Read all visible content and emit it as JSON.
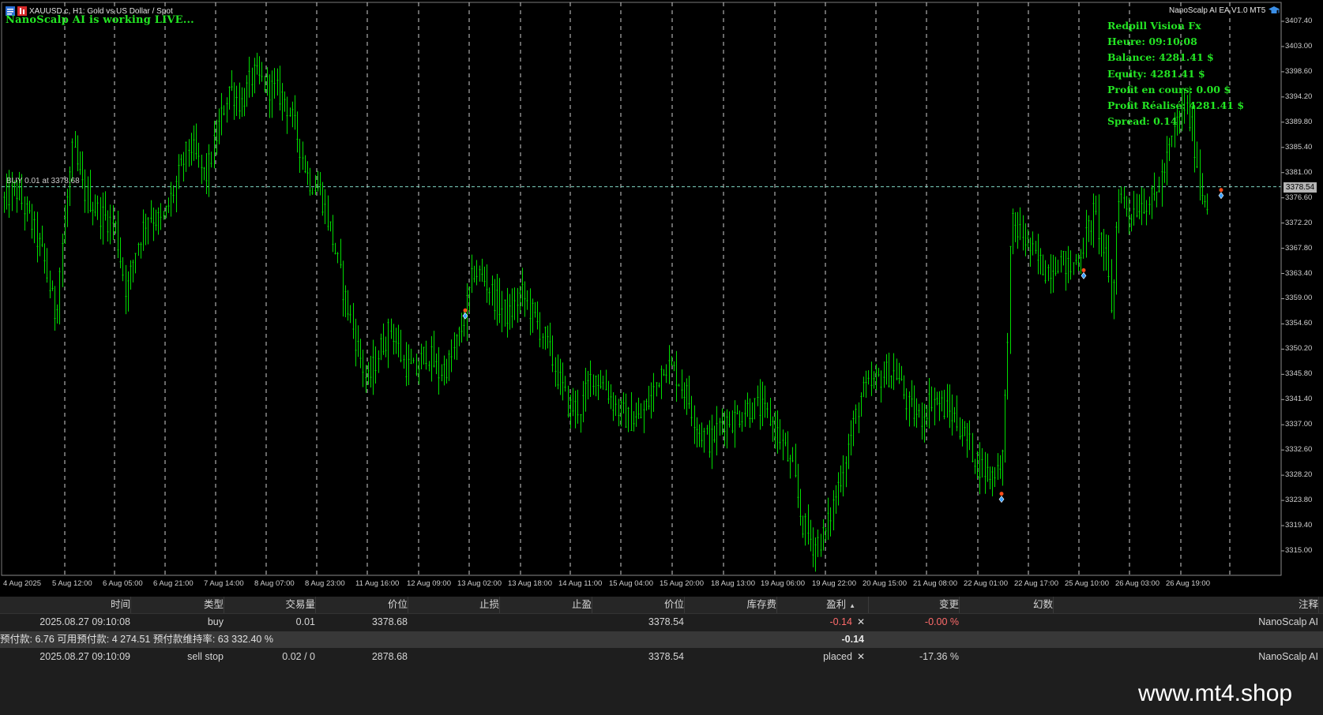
{
  "chart": {
    "symbol_header": "XAUUSD.c, H1:  Gold vs US Dollar / Spot",
    "live_status": "NanoScalp AI is working LIVE...",
    "ea_title": "NanoScalp AI EA V1.0 MT5",
    "info_panel": [
      "Redpill Vision Fx",
      "Heure: 09:10:08",
      "Balance: 4281.41 $",
      "Equity: 4281.41 $",
      "Profit en cours: 0.00 $",
      "Profit Réalisé: 4281.41 $",
      "Spread: 0.14"
    ],
    "position_line_label": "BUY 0.01 at 3378.68",
    "current_price": "3378.54",
    "price_axis": [
      "3407.40",
      "3403.00",
      "3398.60",
      "3394.20",
      "3389.80",
      "3385.40",
      "3381.00",
      "3376.60",
      "3372.20",
      "3367.80",
      "3363.40",
      "3359.00",
      "3354.60",
      "3350.20",
      "3345.80",
      "3341.40",
      "3337.00",
      "3332.60",
      "3328.20",
      "3323.80",
      "3319.40",
      "3315.00"
    ],
    "time_axis": [
      "4 Aug 2025",
      "5 Aug 12:00",
      "6 Aug 05:00",
      "6 Aug 21:00",
      "7 Aug 14:00",
      "8 Aug 07:00",
      "8 Aug 23:00",
      "11 Aug 16:00",
      "12 Aug 09:00",
      "13 Aug 02:00",
      "13 Aug 18:00",
      "14 Aug 11:00",
      "15 Aug 04:00",
      "15 Aug 20:00",
      "18 Aug 13:00",
      "19 Aug 06:00",
      "19 Aug 22:00",
      "20 Aug 15:00",
      "21 Aug 08:00",
      "22 Aug 01:00",
      "22 Aug 17:00",
      "25 Aug 10:00",
      "26 Aug 03:00",
      "26 Aug 19:00"
    ],
    "colors": {
      "candle": "#00dd00",
      "text_green": "#23e523",
      "background": "#000000"
    }
  },
  "table": {
    "headers": [
      "时间",
      "类型",
      "交易量",
      "价位",
      "止损",
      "止盈",
      "价位",
      "库存费",
      "盈利",
      "变更",
      "幻数",
      "注释"
    ],
    "rows": [
      [
        "2025.08.27 09:10:08",
        "buy",
        "0.01",
        "3378.68",
        "",
        "",
        "3378.54",
        "",
        "-0.14",
        "-0.00 %",
        "",
        "NanoScalp AI"
      ],
      [
        "2025.08.27 09:10:09",
        "sell stop",
        "0.02 / 0",
        "2878.68",
        "",
        "",
        "3378.54",
        "",
        "placed",
        "-17.36 %",
        "",
        "NanoScalp  AI"
      ]
    ],
    "summary_text": "预付款: 6.76   可用预付款: 4 274.51   预付款维持率: 63 332.40 %",
    "summary_profit": "-0.14"
  },
  "watermark": "www.mt4.shop"
}
